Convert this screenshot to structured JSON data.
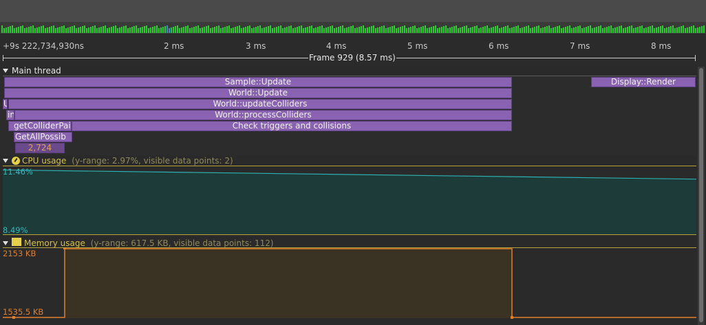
{
  "colors": {
    "zone_purple": "#8a62b2",
    "cpu_line": "#2fb0b0",
    "cpu_fill": "#1c3b39",
    "memory_line": "#e07e2a",
    "memory_fill": "#3a3222",
    "frame_green": "#2fcc2f",
    "section_header_text": "#d4c04a"
  },
  "ruler": {
    "start_label": "+9s 222,734,930ns",
    "ticks": [
      "2 ms",
      "3 ms",
      "4 ms",
      "5 ms",
      "6 ms",
      "7 ms",
      "8 ms"
    ],
    "frame_label": "Frame 929 (8.57 ms)"
  },
  "main_thread": {
    "label": "Main thread",
    "zones": [
      {
        "label": "Sample::Update"
      },
      {
        "label": "World::Update"
      },
      {
        "label": "World::updateColliders"
      },
      {
        "label": "World::processColliders"
      },
      {
        "label": "Check triggers and collisions"
      },
      {
        "label": "getColliderPairs"
      },
      {
        "label": "GetAllPossib"
      },
      {
        "label": "2,724"
      },
      {
        "label": "Display::Render"
      },
      {
        "label": "U"
      },
      {
        "label": "in"
      }
    ]
  },
  "cpu_usage": {
    "label": "CPU usage",
    "icon": "gauge-icon",
    "info": "(y-range: 2.97%, visible data points: 2)",
    "max_label": "11.46%",
    "min_label": "8.49%",
    "chart_data": {
      "type": "line",
      "series": [
        {
          "values": [
            11.3,
            10.9
          ]
        }
      ],
      "ylim": [
        8.49,
        11.46
      ]
    }
  },
  "memory_usage": {
    "label": "Memory usage",
    "icon": "memory-chip-icon",
    "info": "(y-range: 617.5 KB, visible data points: 112)",
    "max_label": "2153 KB",
    "min_label": "1535.5 KB",
    "chart_data": {
      "type": "area",
      "ylim": [
        1535.5,
        2153
      ]
    }
  }
}
